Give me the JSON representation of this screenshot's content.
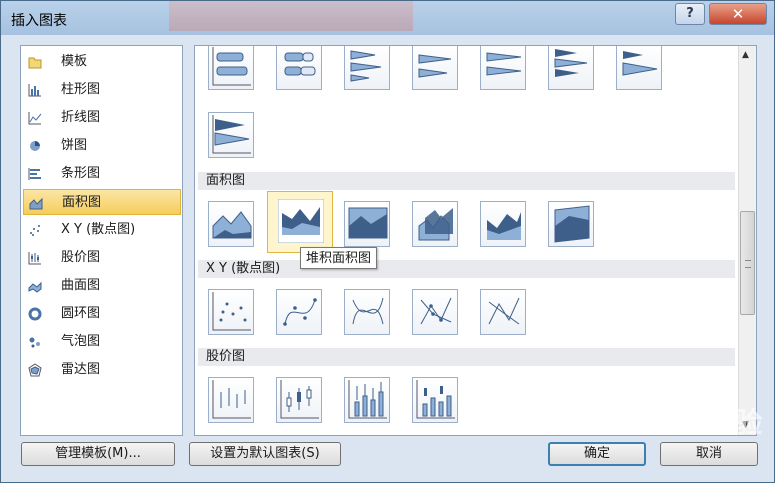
{
  "window": {
    "title": "插入图表",
    "help_label": "?",
    "close_label": "✕"
  },
  "categories": [
    {
      "label": "模板",
      "icon": "folder-icon"
    },
    {
      "label": "柱形图",
      "icon": "column-chart-icon"
    },
    {
      "label": "折线图",
      "icon": "line-chart-icon"
    },
    {
      "label": "饼图",
      "icon": "pie-chart-icon"
    },
    {
      "label": "条形图",
      "icon": "bar-chart-icon"
    },
    {
      "label": "面积图",
      "icon": "area-chart-icon",
      "selected": true
    },
    {
      "label": "X Y (散点图)",
      "icon": "scatter-chart-icon"
    },
    {
      "label": "股价图",
      "icon": "stock-chart-icon"
    },
    {
      "label": "曲面图",
      "icon": "surface-chart-icon"
    },
    {
      "label": "圆环图",
      "icon": "doughnut-chart-icon"
    },
    {
      "label": "气泡图",
      "icon": "bubble-chart-icon"
    },
    {
      "label": "雷达图",
      "icon": "radar-chart-icon"
    }
  ],
  "sections": {
    "area": "面积图",
    "scatter": "X Y (散点图)",
    "stock": "股价图"
  },
  "tooltip": "堆积面积图",
  "buttons": {
    "manage": "管理模板(M)...",
    "set_default": "设置为默认图表(S)",
    "ok": "确定",
    "cancel": "取消"
  },
  "watermark": "Bai du 经验"
}
